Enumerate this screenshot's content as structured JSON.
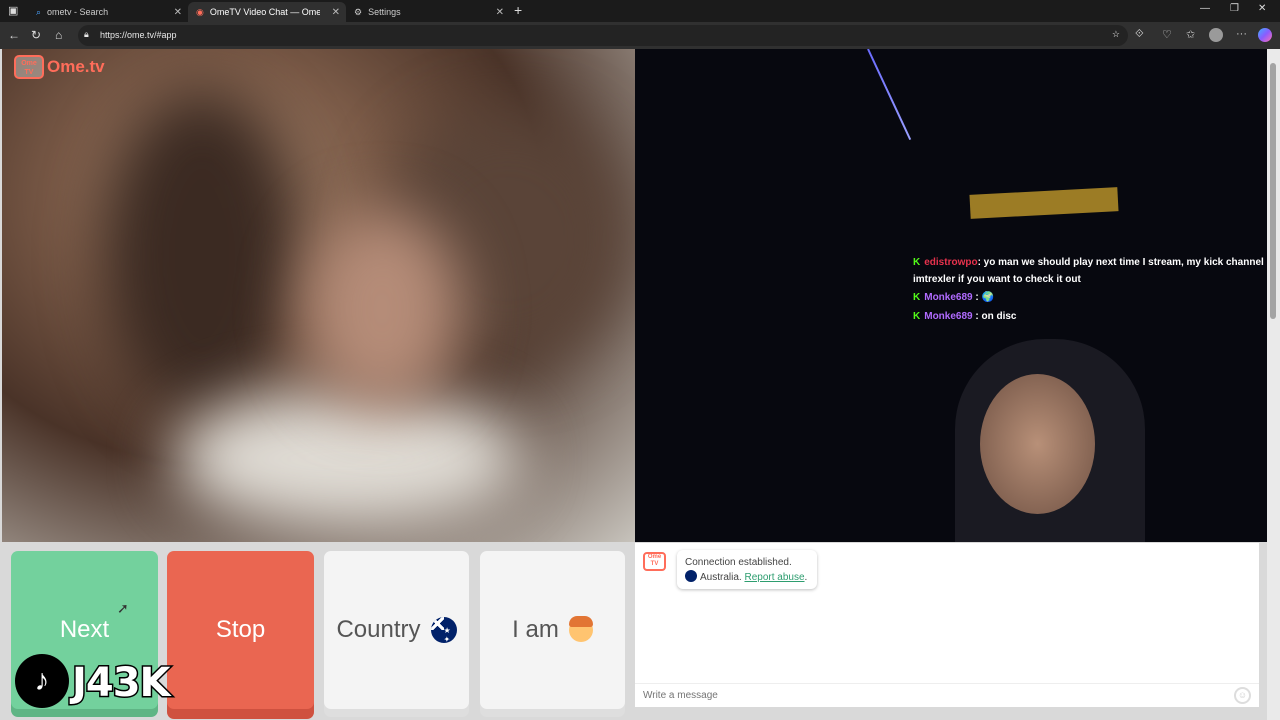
{
  "browser": {
    "tabs": [
      {
        "label": "ometv - Search",
        "icon": "search-icon"
      },
      {
        "label": "OmeTV Video Chat — Omeg",
        "icon": "ometv-icon"
      },
      {
        "label": "Settings",
        "icon": "gear-icon"
      }
    ],
    "url": "https://ome.tv/#app"
  },
  "logo": {
    "box_text": "Ome TV",
    "text": "Ome.tv"
  },
  "stream_chat": [
    {
      "user": "edistrowpo",
      "message": ": yo man we should play next time I stream, my kick channel is imtrexler if you want to check it out"
    },
    {
      "user": "Monke689",
      "message": ": 🌍"
    },
    {
      "user": "Monke689",
      "message": ": on disc"
    }
  ],
  "controls": {
    "next_label": "Next",
    "stop_label": "Stop",
    "country_label": "Country",
    "iam_label": "I am"
  },
  "watermark": {
    "tiktok_glyph": "♪",
    "handle": "J43K"
  },
  "chat": {
    "icon_text": "Ome TV",
    "status": "Connection established.",
    "country": "Australia.",
    "report": "Report abuse",
    "report_suffix": ".",
    "placeholder": "Write a message"
  },
  "colors": {
    "next": "#73d19d",
    "stop": "#ea6651",
    "brand": "#ff6d5a",
    "kick": "#53fc18"
  }
}
